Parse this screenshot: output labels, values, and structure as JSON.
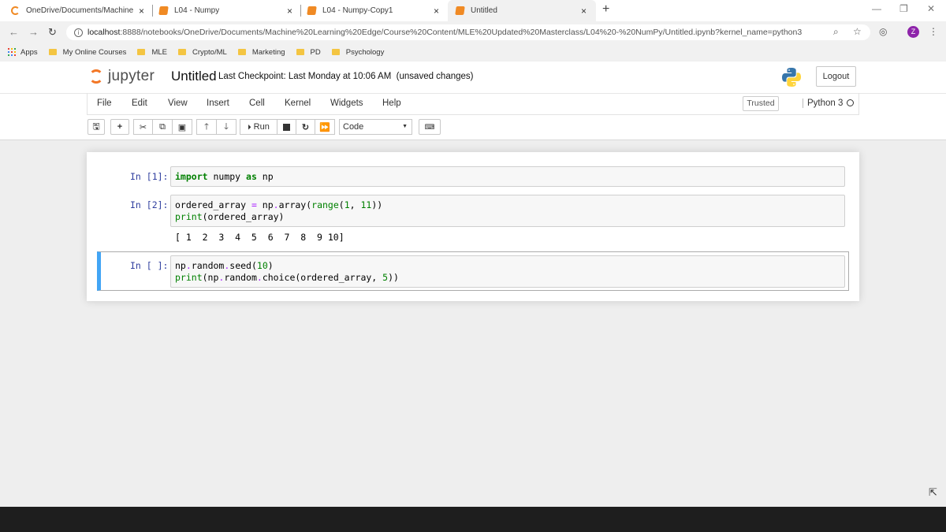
{
  "browser": {
    "tabs": [
      {
        "title": "OneDrive/Documents/Machine L",
        "active": false
      },
      {
        "title": "L04 - Numpy",
        "active": false
      },
      {
        "title": "L04 - Numpy-Copy1",
        "active": false
      },
      {
        "title": "Untitled",
        "active": true
      }
    ],
    "tab_close": "×",
    "new_tab": "+",
    "url_host": "localhost",
    "url_rest": ":8888/notebooks/OneDrive/Documents/Machine%20Learning%20Edge/Course%20Content/MLE%20Updated%20Masterclass/L04%20-%20NumPy/Untitled.ipynb?kernel_name=python3",
    "profile_initial": "Z",
    "bookmarks": [
      "Apps",
      "My Online Courses",
      "MLE",
      "Crypto/ML",
      "Marketing",
      "PD",
      "Psychology"
    ]
  },
  "jupyter": {
    "logo_text": "jupyter",
    "notebook_name": "Untitled",
    "checkpoint": "Last Checkpoint: Last Monday at 10:06 AM",
    "unsaved": "(unsaved changes)",
    "logout_label": "Logout",
    "menu": [
      "File",
      "Edit",
      "View",
      "Insert",
      "Cell",
      "Kernel",
      "Widgets",
      "Help"
    ],
    "trusted_label": "Trusted",
    "kernel_label": "Python 3",
    "run_label": "Run",
    "cell_type": "Code"
  },
  "cells": [
    {
      "prompt": "In [1]:",
      "code_plain": "import numpy as np"
    },
    {
      "prompt": "In [2]:",
      "code_plain": "ordered_array = np.array(range(1, 11))\nprint(ordered_array)",
      "output": "[ 1  2  3  4  5  6  7  8  9 10]"
    },
    {
      "prompt": "In [ ]:",
      "code_plain": "np.random.seed(10)\nprint(np.random.choice(ordered_array, 5))"
    }
  ],
  "colors": {
    "jupyter_orange": "#f37726",
    "prompt_blue": "#303f9f",
    "selected_cell_bar": "#42a5f5",
    "keyword_green": "#008000",
    "operator_purple": "#aa22ff"
  }
}
